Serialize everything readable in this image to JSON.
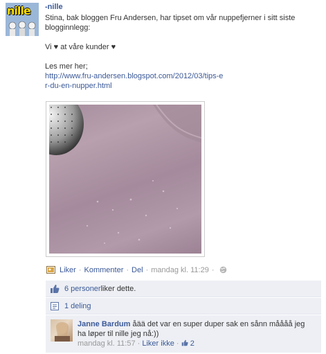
{
  "page": {
    "name": "-nille",
    "logo_text": "nille"
  },
  "post": {
    "line1": "Stina, bak bloggen Fru Andersen, har tipset om vår nuppefjerner i sitt siste blogginnlegg:",
    "line2": "Vi ♥ at våre kunder ♥",
    "line3": "Les mer her;",
    "link": "http://www.fru-andersen.blogspot.com/2012/03/tips-er-du-en-nupper.html"
  },
  "actions": {
    "like": "Liker",
    "comment": "Kommenter",
    "share": "Del",
    "timestamp": "mandag kl. 11:29",
    "separator": "·"
  },
  "feedback": {
    "likes_link": "6 personer",
    "likes_rest": " liker dette.",
    "shares": "1 deling"
  },
  "comment": {
    "author": "Janne Bardum",
    "text": " åää det var en super duper sak en sånn måååå jeg ha løper til nille jeg nå:))",
    "time": "mandag kl. 11:57",
    "unlike": "Liker ikke",
    "like_count": "2",
    "separator": "·"
  },
  "colors": {
    "link": "#3b5998",
    "feedback_bg": "#edeff4",
    "meta": "#999999"
  },
  "icons": [
    "photo-icon",
    "globe-icon",
    "thumbs-up-icon",
    "share-icon",
    "thumbs-up-small-icon"
  ]
}
